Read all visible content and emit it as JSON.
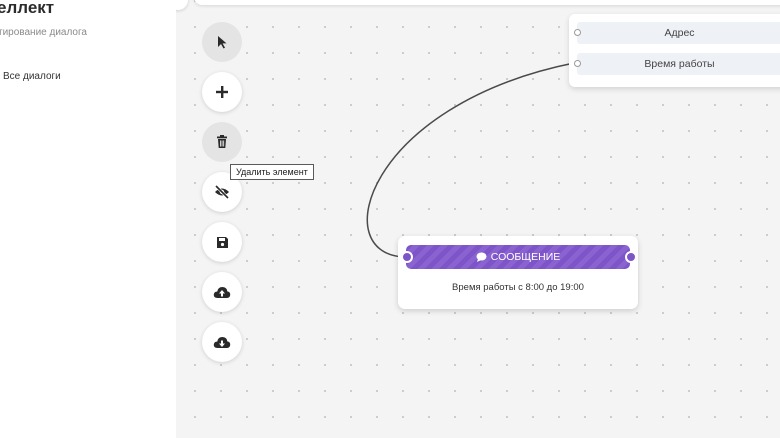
{
  "sidebar": {
    "brand_title": "еллект",
    "brand_subtitle": "тирование диалога",
    "nav_item": "Все диалоги"
  },
  "toolbar": {
    "tools": [
      {
        "name": "select-tool",
        "icon": "cursor-icon"
      },
      {
        "name": "add-tool",
        "icon": "plus-icon"
      },
      {
        "name": "delete-tool",
        "icon": "trash-icon"
      },
      {
        "name": "hide-tool",
        "icon": "eye-slash-icon"
      },
      {
        "name": "save-tool",
        "icon": "save-icon"
      },
      {
        "name": "upload-tool",
        "icon": "cloud-upload-icon"
      },
      {
        "name": "download-tool",
        "icon": "cloud-download-icon"
      }
    ],
    "active_tool": "select-tool",
    "tooltip": "Удалить элемент"
  },
  "nodes": {
    "fields_node": {
      "rows": [
        "Адрес",
        "Время работы"
      ]
    },
    "message_node": {
      "header": "СООБЩЕНИЕ",
      "icon": "chat-bubble-icon",
      "body": "Время работы с 8:00 до 19:00"
    }
  },
  "colors": {
    "accent": "#7e54c9",
    "canvas_bg": "#f4f4f4"
  }
}
